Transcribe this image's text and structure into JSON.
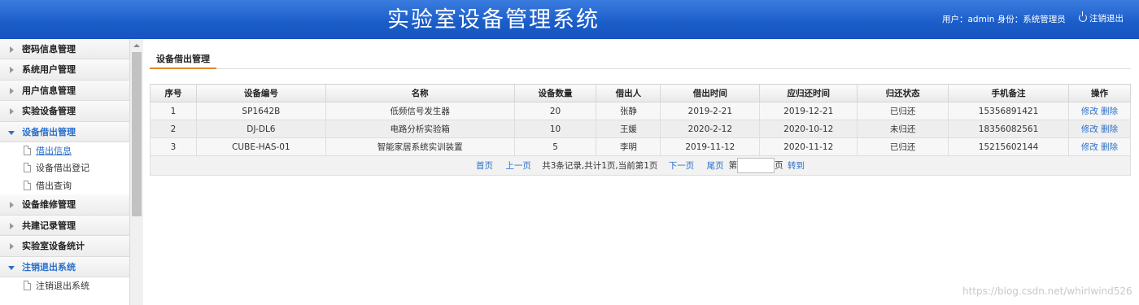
{
  "header": {
    "title": "实验室设备管理系统",
    "user_info": "用户：admin 身份：系统管理员",
    "logout_label": "注销退出",
    "bg_color": "#1a5cc8"
  },
  "sidebar": {
    "items": [
      {
        "label": "密码信息管理"
      },
      {
        "label": "系统用户管理"
      },
      {
        "label": "用户信息管理"
      },
      {
        "label": "实验设备管理"
      },
      {
        "label": "设备借出管理",
        "sub": [
          "借出信息",
          "设备借出登记",
          "借出查询"
        ]
      },
      {
        "label": "设备维修管理"
      },
      {
        "label": "共建记录管理"
      },
      {
        "label": "实验室设备统计"
      },
      {
        "label": "注销退出系统",
        "sub": [
          "注销退出系统"
        ]
      }
    ]
  },
  "tab": {
    "label": "设备借出管理",
    "accent": "#e08a2a"
  },
  "table": {
    "headers": [
      "序号",
      "设备编号",
      "名称",
      "设备数量",
      "借出人",
      "借出时间",
      "应归还时间",
      "归还状态",
      "手机备注",
      "操作"
    ],
    "rows": [
      [
        "1",
        "SP1642B",
        "低频信号发生器",
        "20",
        "张静",
        "2019-2-21",
        "2019-12-21",
        "已归还",
        "15356891421"
      ],
      [
        "2",
        "DJ-DL6",
        "电路分析实验箱",
        "10",
        "王媛",
        "2020-2-12",
        "2020-10-12",
        "未归还",
        "18356082561"
      ],
      [
        "3",
        "CUBE-HAS-01",
        "智能家居系统实训装置",
        "5",
        "李明",
        "2019-11-12",
        "2020-11-12",
        "已归还",
        "15215602144"
      ]
    ],
    "actions": {
      "edit": "修改",
      "delete": "删除"
    }
  },
  "pager": {
    "first": "首页",
    "prev": "上一页",
    "info": "共3条记录,共计1页,当前第1页",
    "next": "下一页",
    "last": "尾页",
    "page_prefix": "第",
    "page_suffix": "页",
    "goto": "转到"
  },
  "watermark": "https://blog.csdn.net/whirlwind526"
}
